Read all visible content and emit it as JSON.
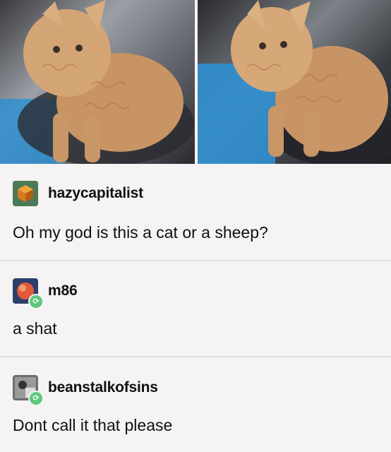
{
  "photos": [
    {
      "alt_icon": "curly-kitten-photo"
    },
    {
      "alt_icon": "curly-kitten-photo"
    }
  ],
  "notes": [
    {
      "username": "hazycapitalist",
      "text": "Oh my god is this a cat or a sheep?",
      "avatar_icon": "cube-avatar-icon",
      "reblog": false
    },
    {
      "username": "m86",
      "text": "a shat",
      "avatar_icon": "planet-avatar-icon",
      "reblog": true
    },
    {
      "username": "beanstalkofsins",
      "text": "Dont call it that please",
      "avatar_icon": "photo-avatar-icon",
      "reblog": true
    }
  ],
  "colors": {
    "background": "#f6f3f4",
    "divider": "#e4dfe1",
    "reblog_badge": "#5cc97a"
  },
  "reblog_glyph": "⟳"
}
